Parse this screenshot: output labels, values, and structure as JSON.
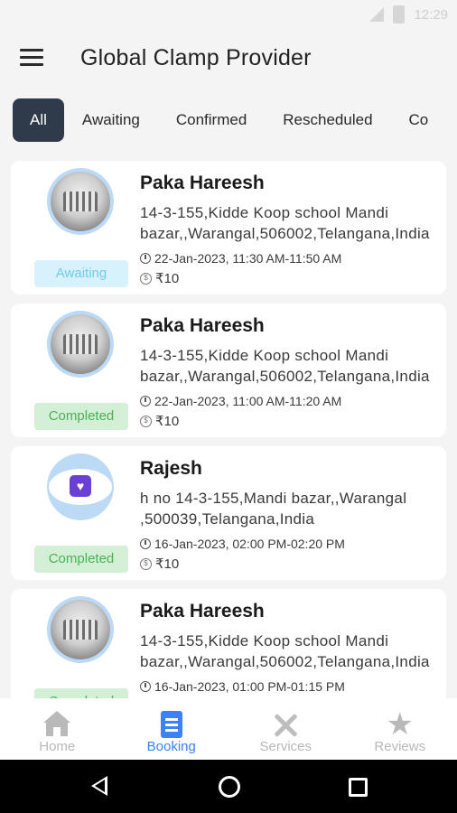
{
  "status_bar": {
    "time": "12:29"
  },
  "app_bar": {
    "title": "Global Clamp Provider"
  },
  "tabs": [
    {
      "label": "All",
      "active": true
    },
    {
      "label": "Awaiting"
    },
    {
      "label": "Confirmed"
    },
    {
      "label": "Rescheduled"
    },
    {
      "label": "Co"
    }
  ],
  "bookings": [
    {
      "name": "Paka Hareesh",
      "address": "14-3-155,Kidde Koop school Mandi bazar,,Warangal,506002,Telangana,India",
      "time": "22-Jan-2023, 11:30 AM-11:50 AM",
      "price": "₹10",
      "status": "Awaiting",
      "avatar": "building-photo"
    },
    {
      "name": "Paka Hareesh",
      "address": "14-3-155,Kidde Koop school Mandi bazar,,Warangal,506002,Telangana,India",
      "time": "22-Jan-2023, 11:00 AM-11:20 AM",
      "price": "₹10",
      "status": "Completed",
      "avatar": "building-photo"
    },
    {
      "name": "Rajesh",
      "address": "h no 14-3-155,Mandi bazar,,Warangal ,500039,Telangana,India",
      "time": "16-Jan-2023, 02:00 PM-02:20 PM",
      "price": "₹10",
      "status": "Completed",
      "avatar": "profile-photo"
    },
    {
      "name": "Paka Hareesh",
      "address": "14-3-155,Kidde Koop school Mandi bazar,,Warangal,506002,Telangana,India",
      "time": "16-Jan-2023, 01:00 PM-01:15 PM",
      "price": "",
      "status": "Completed",
      "avatar": "building-photo"
    }
  ],
  "bottom_nav": [
    {
      "label": "Home",
      "icon": "home-icon"
    },
    {
      "label": "Booking",
      "icon": "booking-icon",
      "active": true
    },
    {
      "label": "Services",
      "icon": "services-icon"
    },
    {
      "label": "Reviews",
      "icon": "star-icon"
    }
  ],
  "colors": {
    "tab_active_bg": "#2f3a4b",
    "accent": "#3b82f6",
    "awaiting_bg": "#d7f2fd",
    "awaiting_text": "#6fcaec",
    "completed_bg": "#d3f0d6",
    "completed_text": "#4caf58"
  }
}
